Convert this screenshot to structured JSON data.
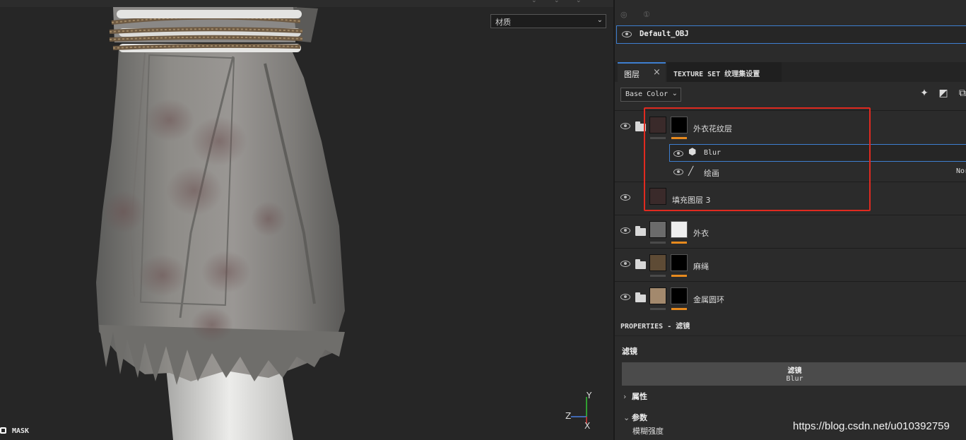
{
  "viewport": {
    "material_select": {
      "value": "材质",
      "chevron_icon": "chevron-down-icon"
    },
    "mask_label": "MASK",
    "axis": {
      "y": "Y",
      "z": "Z",
      "x": "X"
    }
  },
  "panel": {
    "texture_set": {
      "name": "Default_OBJ"
    },
    "tabs": [
      {
        "label": "图层",
        "close": "×"
      },
      {
        "label": "TEXTURE SET 纹理集设置"
      }
    ],
    "channel": {
      "value": "Base Color"
    },
    "layers": [
      {
        "name": "外衣花纹层",
        "type": "folder",
        "children": [
          {
            "name": "Blur",
            "icon": "filter-icon",
            "selected": true
          },
          {
            "name": "绘画",
            "icon": "brush-icon",
            "blend": "Nor"
          }
        ]
      },
      {
        "name": "填充图层 3",
        "type": "fill"
      },
      {
        "name": "外衣",
        "type": "folder"
      },
      {
        "name": "麻绳",
        "type": "folder"
      },
      {
        "name": "金属圆环",
        "type": "folder"
      }
    ],
    "properties": {
      "title": "PROPERTIES - 滤镜",
      "filter_heading": "滤镜",
      "filter_box_heading": "滤镜",
      "filter_value": "Blur",
      "section_attributes": "属性",
      "section_params": "参数",
      "param_blur_strength": "模糊强度"
    }
  },
  "watermark": "https://blog.csdn.net/u010392759",
  "colors": {
    "accent": "#3e7fd0",
    "highlight": "#e02a20",
    "mask_bar": "#e78a1e"
  }
}
